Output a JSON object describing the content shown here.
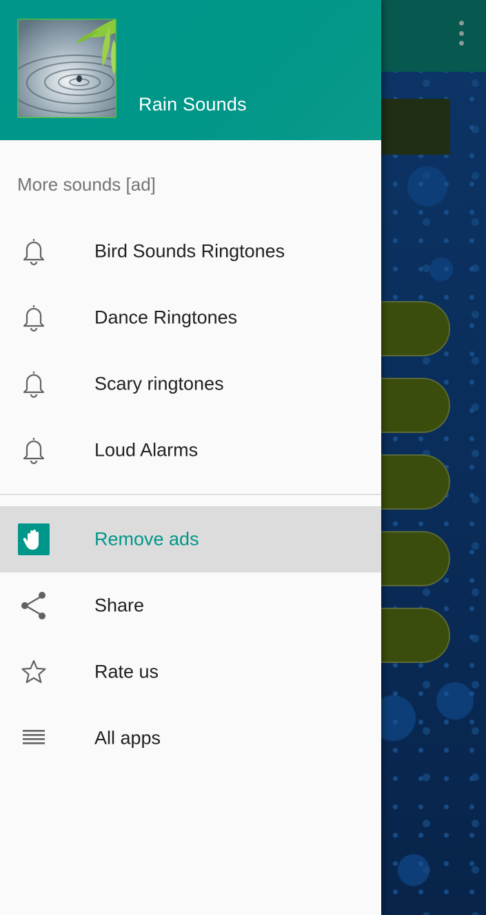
{
  "header": {
    "app_name": "Rain Sounds",
    "logo": "rain-droplet-ripple-logo"
  },
  "more_sounds": {
    "title": "More sounds [ad]",
    "items": [
      {
        "label": "Bird Sounds Ringtones",
        "icon": "bell-icon"
      },
      {
        "label": "Dance Ringtones",
        "icon": "bell-icon"
      },
      {
        "label": "Scary ringtones",
        "icon": "bell-icon"
      },
      {
        "label": "Loud Alarms",
        "icon": "bell-icon"
      }
    ]
  },
  "actions": {
    "items": [
      {
        "label": "Remove ads",
        "icon": "hand-stop-icon",
        "selected": true
      },
      {
        "label": "Share",
        "icon": "share-icon"
      },
      {
        "label": "Rate us",
        "icon": "star-icon"
      },
      {
        "label": "All apps",
        "icon": "list-icon"
      }
    ]
  },
  "colors": {
    "accent": "#009688",
    "header_bg": "#009688",
    "selected_bg": "#dcdcdc",
    "background_app_bar": "#07584f",
    "background_button": "#3b4d0c"
  }
}
